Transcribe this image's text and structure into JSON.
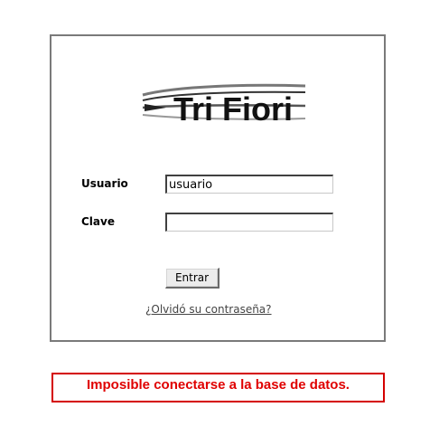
{
  "login": {
    "logo_text": "Tri Fiori",
    "username_label": "Usuario",
    "username_value": "usuario",
    "password_label": "Clave",
    "password_value": "",
    "submit_label": "Entrar",
    "forgot_label": "¿Olvidó su contraseña?"
  },
  "error": {
    "message": "Imposible conectarse a la base de datos.",
    "color": "#e00000"
  },
  "colors": {
    "box_border": "#7a7a7a",
    "error_border": "#d40000"
  }
}
